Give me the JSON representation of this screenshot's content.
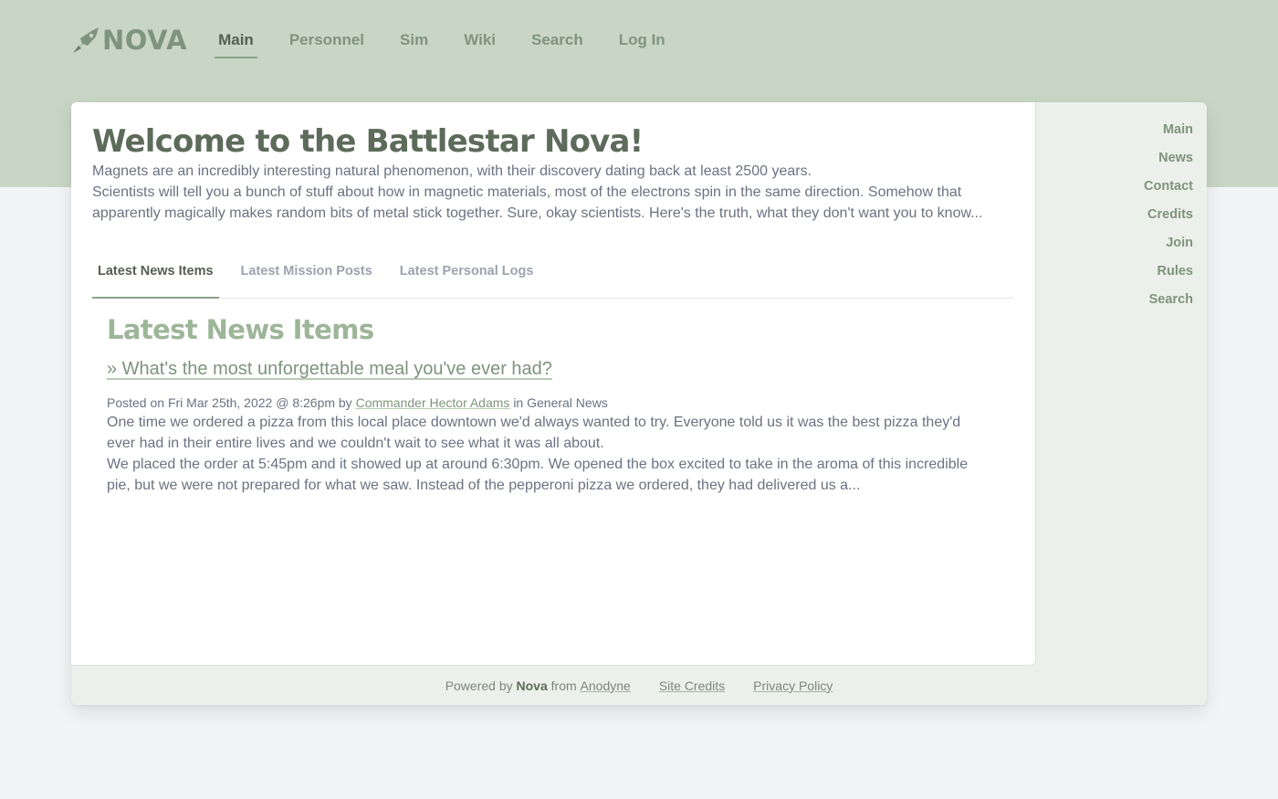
{
  "header": {
    "logo_text": "NOVA",
    "nav": [
      {
        "label": "Main",
        "active": true
      },
      {
        "label": "Personnel",
        "active": false
      },
      {
        "label": "Sim",
        "active": false
      },
      {
        "label": "Wiki",
        "active": false
      },
      {
        "label": "Search",
        "active": false
      },
      {
        "label": "Log In",
        "active": false
      }
    ]
  },
  "sidebar": {
    "items": [
      {
        "label": "Main"
      },
      {
        "label": "News"
      },
      {
        "label": "Contact"
      },
      {
        "label": "Credits"
      },
      {
        "label": "Join"
      },
      {
        "label": "Rules"
      },
      {
        "label": "Search"
      }
    ]
  },
  "main": {
    "title": "Welcome to the Battlestar Nova!",
    "intro": [
      "Magnets are an incredibly interesting natural phenomenon, with their discovery dating back at least 2500 years.",
      "Scientists will tell you a bunch of stuff about how in magnetic materials, most of the electrons spin in the same direction. Somehow that apparently magically makes random bits of metal stick together. Sure, okay scientists. Here's the truth, what they don't want you to know..."
    ],
    "tabs": [
      {
        "label": "Latest News Items",
        "active": true
      },
      {
        "label": "Latest Mission Posts",
        "active": false
      },
      {
        "label": "Latest Personal Logs",
        "active": false
      }
    ],
    "news": {
      "heading": "Latest News Items",
      "post": {
        "title": "» What's the most unforgettable meal you've ever had?",
        "meta_prefix": "Posted on Fri Mar 25th, 2022 @ 8:26pm by",
        "author": "Commander Hector Adams",
        "meta_mid": "in",
        "category": "General News",
        "paragraphs": [
          "One time we ordered a pizza from this local place downtown we'd always wanted to try. Everyone told us it was the best pizza they'd ever had in their entire lives and we couldn't wait to see what it was all about.",
          "We placed the order at 5:45pm and it showed up at around 6:30pm. We opened the box excited to take in the aroma of this incredible pie, but we were not prepared for what we saw. Instead of the pepperoni pizza we ordered, they had delivered us a..."
        ]
      }
    }
  },
  "footer": {
    "powered_by": "Powered by",
    "product": "Nova",
    "from": "from",
    "vendor": "Anodyne",
    "site_credits": "Site Credits",
    "privacy": "Privacy Policy"
  },
  "colors": {
    "header_band": "#c9d6c5",
    "accent": "#7e947c",
    "heading": "#5d6b5b",
    "news_heading": "#9db598",
    "page_bg": "#f3f4f6"
  },
  "icons": {
    "logo": "nova-rocket-logo-icon"
  }
}
